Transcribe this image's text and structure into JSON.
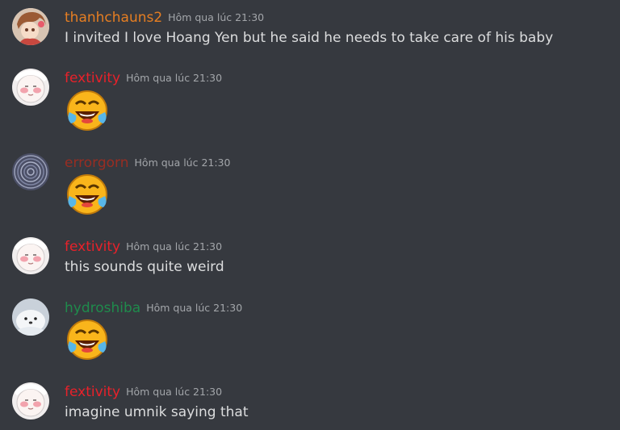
{
  "colors": {
    "background": "#36393f",
    "text": "#dcddde",
    "timestamp": "#a3a6aa"
  },
  "messages": [
    {
      "username": "thanhchauns2",
      "username_color": "#e67e22",
      "timestamp": "Hôm qua lúc 21:30",
      "avatar": "anime-girl-avatar",
      "text": "I invited I love Hoang Yen but he said he needs to take care of his baby"
    },
    {
      "username": "fextivity",
      "username_color": "#e8212a",
      "timestamp": "Hôm qua lúc 21:30",
      "avatar": "blush-face-avatar",
      "emoji": "crying-laughing-emoji"
    },
    {
      "username": "errorgorn",
      "username_color": "#992d22",
      "timestamp": "Hôm qua lúc 21:30",
      "avatar": "spiral-avatar",
      "emoji": "crying-laughing-emoji"
    },
    {
      "username": "fextivity",
      "username_color": "#e8212a",
      "timestamp": "Hôm qua lúc 21:30",
      "avatar": "blush-face-avatar",
      "text": "this sounds quite weird"
    },
    {
      "username": "hydroshiba",
      "username_color": "#1f8b4c",
      "timestamp": "Hôm qua lúc 21:30",
      "avatar": "seal-avatar",
      "emoji": "crying-laughing-emoji"
    },
    {
      "username": "fextivity",
      "username_color": "#e8212a",
      "timestamp": "Hôm qua lúc 21:30",
      "avatar": "blush-face-avatar",
      "text": "imagine umnik saying that"
    }
  ]
}
